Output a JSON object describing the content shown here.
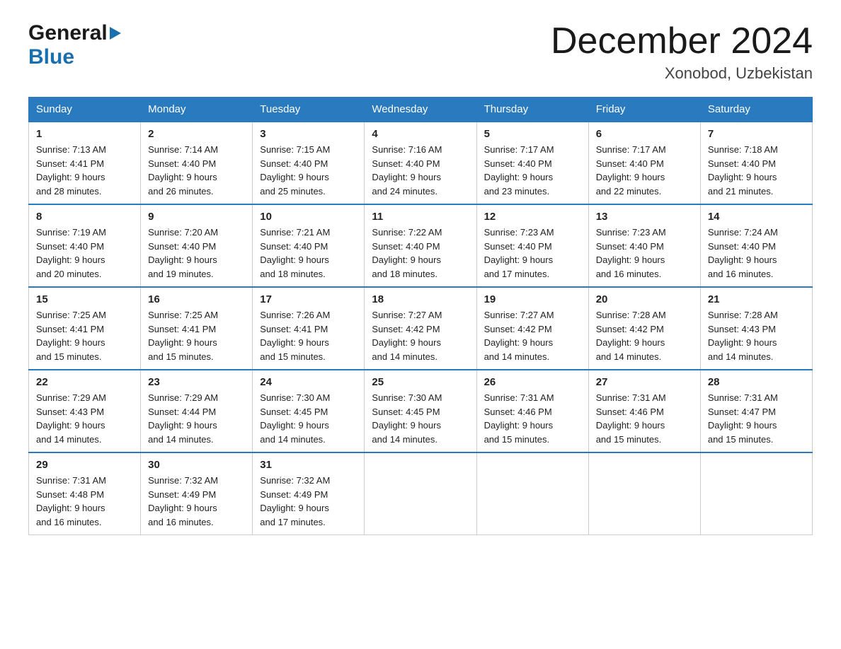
{
  "header": {
    "logo_general": "General",
    "logo_blue": "Blue",
    "month_title": "December 2024",
    "location": "Xonobod, Uzbekistan"
  },
  "weekdays": [
    "Sunday",
    "Monday",
    "Tuesday",
    "Wednesday",
    "Thursday",
    "Friday",
    "Saturday"
  ],
  "weeks": [
    [
      {
        "day": "1",
        "sunrise": "7:13 AM",
        "sunset": "4:41 PM",
        "daylight": "9 hours and 28 minutes."
      },
      {
        "day": "2",
        "sunrise": "7:14 AM",
        "sunset": "4:40 PM",
        "daylight": "9 hours and 26 minutes."
      },
      {
        "day": "3",
        "sunrise": "7:15 AM",
        "sunset": "4:40 PM",
        "daylight": "9 hours and 25 minutes."
      },
      {
        "day": "4",
        "sunrise": "7:16 AM",
        "sunset": "4:40 PM",
        "daylight": "9 hours and 24 minutes."
      },
      {
        "day": "5",
        "sunrise": "7:17 AM",
        "sunset": "4:40 PM",
        "daylight": "9 hours and 23 minutes."
      },
      {
        "day": "6",
        "sunrise": "7:17 AM",
        "sunset": "4:40 PM",
        "daylight": "9 hours and 22 minutes."
      },
      {
        "day": "7",
        "sunrise": "7:18 AM",
        "sunset": "4:40 PM",
        "daylight": "9 hours and 21 minutes."
      }
    ],
    [
      {
        "day": "8",
        "sunrise": "7:19 AM",
        "sunset": "4:40 PM",
        "daylight": "9 hours and 20 minutes."
      },
      {
        "day": "9",
        "sunrise": "7:20 AM",
        "sunset": "4:40 PM",
        "daylight": "9 hours and 19 minutes."
      },
      {
        "day": "10",
        "sunrise": "7:21 AM",
        "sunset": "4:40 PM",
        "daylight": "9 hours and 18 minutes."
      },
      {
        "day": "11",
        "sunrise": "7:22 AM",
        "sunset": "4:40 PM",
        "daylight": "9 hours and 18 minutes."
      },
      {
        "day": "12",
        "sunrise": "7:23 AM",
        "sunset": "4:40 PM",
        "daylight": "9 hours and 17 minutes."
      },
      {
        "day": "13",
        "sunrise": "7:23 AM",
        "sunset": "4:40 PM",
        "daylight": "9 hours and 16 minutes."
      },
      {
        "day": "14",
        "sunrise": "7:24 AM",
        "sunset": "4:40 PM",
        "daylight": "9 hours and 16 minutes."
      }
    ],
    [
      {
        "day": "15",
        "sunrise": "7:25 AM",
        "sunset": "4:41 PM",
        "daylight": "9 hours and 15 minutes."
      },
      {
        "day": "16",
        "sunrise": "7:25 AM",
        "sunset": "4:41 PM",
        "daylight": "9 hours and 15 minutes."
      },
      {
        "day": "17",
        "sunrise": "7:26 AM",
        "sunset": "4:41 PM",
        "daylight": "9 hours and 15 minutes."
      },
      {
        "day": "18",
        "sunrise": "7:27 AM",
        "sunset": "4:42 PM",
        "daylight": "9 hours and 14 minutes."
      },
      {
        "day": "19",
        "sunrise": "7:27 AM",
        "sunset": "4:42 PM",
        "daylight": "9 hours and 14 minutes."
      },
      {
        "day": "20",
        "sunrise": "7:28 AM",
        "sunset": "4:42 PM",
        "daylight": "9 hours and 14 minutes."
      },
      {
        "day": "21",
        "sunrise": "7:28 AM",
        "sunset": "4:43 PM",
        "daylight": "9 hours and 14 minutes."
      }
    ],
    [
      {
        "day": "22",
        "sunrise": "7:29 AM",
        "sunset": "4:43 PM",
        "daylight": "9 hours and 14 minutes."
      },
      {
        "day": "23",
        "sunrise": "7:29 AM",
        "sunset": "4:44 PM",
        "daylight": "9 hours and 14 minutes."
      },
      {
        "day": "24",
        "sunrise": "7:30 AM",
        "sunset": "4:45 PM",
        "daylight": "9 hours and 14 minutes."
      },
      {
        "day": "25",
        "sunrise": "7:30 AM",
        "sunset": "4:45 PM",
        "daylight": "9 hours and 14 minutes."
      },
      {
        "day": "26",
        "sunrise": "7:31 AM",
        "sunset": "4:46 PM",
        "daylight": "9 hours and 15 minutes."
      },
      {
        "day": "27",
        "sunrise": "7:31 AM",
        "sunset": "4:46 PM",
        "daylight": "9 hours and 15 minutes."
      },
      {
        "day": "28",
        "sunrise": "7:31 AM",
        "sunset": "4:47 PM",
        "daylight": "9 hours and 15 minutes."
      }
    ],
    [
      {
        "day": "29",
        "sunrise": "7:31 AM",
        "sunset": "4:48 PM",
        "daylight": "9 hours and 16 minutes."
      },
      {
        "day": "30",
        "sunrise": "7:32 AM",
        "sunset": "4:49 PM",
        "daylight": "9 hours and 16 minutes."
      },
      {
        "day": "31",
        "sunrise": "7:32 AM",
        "sunset": "4:49 PM",
        "daylight": "9 hours and 17 minutes."
      },
      null,
      null,
      null,
      null
    ]
  ],
  "labels": {
    "sunrise": "Sunrise:",
    "sunset": "Sunset:",
    "daylight": "Daylight:"
  }
}
